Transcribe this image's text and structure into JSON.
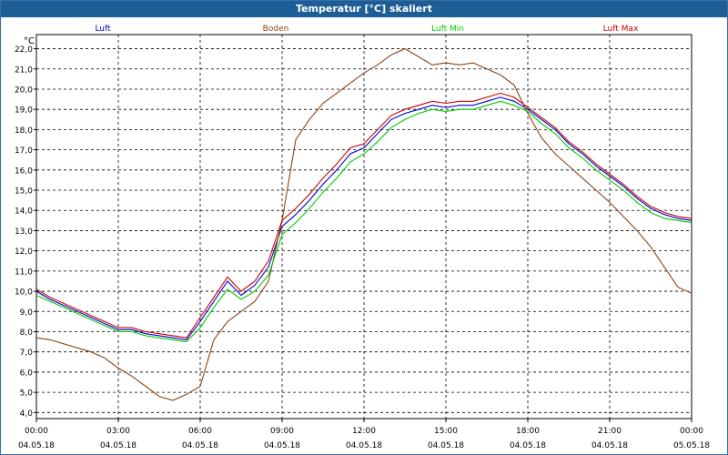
{
  "window": {
    "title": "Temperatur [°C] skaliert"
  },
  "colors": {
    "background": "#ffffff",
    "titlebar": "#1d5e96",
    "grid": "#000000",
    "axis": "#000000"
  },
  "chart_data": {
    "type": "line",
    "title": "Temperatur [°C] skaliert",
    "ylabel": "°C",
    "xlabel": "",
    "ylim": [
      3.7,
      22.7
    ],
    "yticks": [
      4.0,
      5.0,
      6.0,
      7.0,
      8.0,
      9.0,
      10.0,
      11.0,
      12.0,
      13.0,
      14.0,
      15.0,
      16.0,
      17.0,
      18.0,
      19.0,
      20.0,
      21.0,
      22.0
    ],
    "ytick_labels": [
      "4,0",
      "5,0",
      "6,0",
      "7,0",
      "8,0",
      "9,0",
      "10,0",
      "11,0",
      "12,0",
      "13,0",
      "14,0",
      "15,0",
      "16,0",
      "17,0",
      "18,0",
      "19,0",
      "20,0",
      "21,0",
      "22,0"
    ],
    "xlim": [
      0,
      24
    ],
    "xticks": [
      0,
      3,
      6,
      9,
      12,
      15,
      18,
      21,
      24
    ],
    "xtick_times": [
      "00:00",
      "03:00",
      "06:00",
      "09:00",
      "12:00",
      "15:00",
      "18:00",
      "21:00",
      "00:00"
    ],
    "xtick_dates": [
      "04.05.18",
      "04.05.18",
      "04.05.18",
      "04.05.18",
      "04.05.18",
      "04.05.18",
      "04.05.18",
      "04.05.18",
      "05.05.18"
    ],
    "grid": true,
    "legend_position": "top",
    "series": [
      {
        "name": "Luft",
        "color": "#0000cc",
        "points": [
          [
            0,
            10.0
          ],
          [
            0.5,
            9.6
          ],
          [
            1,
            9.3
          ],
          [
            1.5,
            9.0
          ],
          [
            2,
            8.7
          ],
          [
            2.5,
            8.4
          ],
          [
            3,
            8.1
          ],
          [
            3.5,
            8.1
          ],
          [
            4,
            7.9
          ],
          [
            4.5,
            7.8
          ],
          [
            5,
            7.7
          ],
          [
            5.5,
            7.6
          ],
          [
            6,
            8.5
          ],
          [
            6.5,
            9.5
          ],
          [
            7,
            10.5
          ],
          [
            7.5,
            9.8
          ],
          [
            8,
            10.3
          ],
          [
            8.5,
            11.2
          ],
          [
            9,
            13.2
          ],
          [
            9.5,
            13.8
          ],
          [
            10,
            14.5
          ],
          [
            10.5,
            15.3
          ],
          [
            11,
            16.0
          ],
          [
            11.5,
            16.8
          ],
          [
            12,
            17.1
          ],
          [
            12.5,
            17.8
          ],
          [
            13,
            18.5
          ],
          [
            13.5,
            18.8
          ],
          [
            14,
            19.0
          ],
          [
            14.5,
            19.2
          ],
          [
            15,
            19.1
          ],
          [
            15.5,
            19.2
          ],
          [
            16,
            19.2
          ],
          [
            16.5,
            19.4
          ],
          [
            17,
            19.6
          ],
          [
            17.5,
            19.4
          ],
          [
            18,
            19.0
          ],
          [
            18.5,
            18.5
          ],
          [
            19,
            18.0
          ],
          [
            19.5,
            17.3
          ],
          [
            20,
            16.8
          ],
          [
            20.5,
            16.2
          ],
          [
            21,
            15.7
          ],
          [
            21.5,
            15.2
          ],
          [
            22,
            14.6
          ],
          [
            22.5,
            14.1
          ],
          [
            23,
            13.8
          ],
          [
            23.5,
            13.6
          ],
          [
            24,
            13.5
          ]
        ]
      },
      {
        "name": "Boden",
        "color": "#8b4513",
        "points": [
          [
            0,
            7.7
          ],
          [
            0.5,
            7.6
          ],
          [
            1,
            7.4
          ],
          [
            1.5,
            7.2
          ],
          [
            2,
            7.0
          ],
          [
            2.5,
            6.7
          ],
          [
            3,
            6.2
          ],
          [
            3.5,
            5.8
          ],
          [
            4,
            5.3
          ],
          [
            4.5,
            4.8
          ],
          [
            5,
            4.6
          ],
          [
            5.5,
            4.9
          ],
          [
            6,
            5.3
          ],
          [
            6.5,
            7.6
          ],
          [
            7,
            8.5
          ],
          [
            7.5,
            9.0
          ],
          [
            8,
            9.5
          ],
          [
            8.5,
            10.5
          ],
          [
            9,
            13.5
          ],
          [
            9.5,
            17.5
          ],
          [
            10,
            18.5
          ],
          [
            10.5,
            19.3
          ],
          [
            11,
            19.8
          ],
          [
            11.5,
            20.3
          ],
          [
            12,
            20.8
          ],
          [
            12.5,
            21.2
          ],
          [
            13,
            21.7
          ],
          [
            13.5,
            22.0
          ],
          [
            14,
            21.6
          ],
          [
            14.5,
            21.2
          ],
          [
            15,
            21.3
          ],
          [
            15.5,
            21.2
          ],
          [
            16,
            21.3
          ],
          [
            16.5,
            21.0
          ],
          [
            17,
            20.7
          ],
          [
            17.5,
            20.2
          ],
          [
            18,
            18.8
          ],
          [
            18.5,
            17.6
          ],
          [
            19,
            16.8
          ],
          [
            19.5,
            16.2
          ],
          [
            20,
            15.6
          ],
          [
            20.5,
            15.0
          ],
          [
            21,
            14.4
          ],
          [
            21.5,
            13.7
          ],
          [
            22,
            13.0
          ],
          [
            22.5,
            12.2
          ],
          [
            23,
            11.2
          ],
          [
            23.5,
            10.2
          ],
          [
            24,
            9.9
          ]
        ]
      },
      {
        "name": "Luft Min",
        "color": "#00cc00",
        "points": [
          [
            0,
            9.8
          ],
          [
            0.5,
            9.5
          ],
          [
            1,
            9.2
          ],
          [
            1.5,
            8.9
          ],
          [
            2,
            8.6
          ],
          [
            2.5,
            8.3
          ],
          [
            3,
            8.0
          ],
          [
            3.5,
            8.0
          ],
          [
            4,
            7.8
          ],
          [
            4.5,
            7.7
          ],
          [
            5,
            7.6
          ],
          [
            5.5,
            7.5
          ],
          [
            6,
            8.2
          ],
          [
            6.5,
            9.2
          ],
          [
            7,
            10.1
          ],
          [
            7.5,
            9.6
          ],
          [
            8,
            10.0
          ],
          [
            8.5,
            10.8
          ],
          [
            9,
            12.8
          ],
          [
            9.5,
            13.4
          ],
          [
            10,
            14.1
          ],
          [
            10.5,
            14.9
          ],
          [
            11,
            15.6
          ],
          [
            11.5,
            16.4
          ],
          [
            12,
            16.8
          ],
          [
            12.5,
            17.4
          ],
          [
            13,
            18.1
          ],
          [
            13.5,
            18.5
          ],
          [
            14,
            18.8
          ],
          [
            14.5,
            19.0
          ],
          [
            15,
            18.9
          ],
          [
            15.5,
            19.0
          ],
          [
            16,
            19.0
          ],
          [
            16.5,
            19.2
          ],
          [
            17,
            19.4
          ],
          [
            17.5,
            19.2
          ],
          [
            18,
            18.9
          ],
          [
            18.5,
            18.3
          ],
          [
            19,
            17.8
          ],
          [
            19.5,
            17.1
          ],
          [
            20,
            16.6
          ],
          [
            20.5,
            16.0
          ],
          [
            21,
            15.5
          ],
          [
            21.5,
            15.0
          ],
          [
            22,
            14.4
          ],
          [
            22.5,
            13.9
          ],
          [
            23,
            13.6
          ],
          [
            23.5,
            13.5
          ],
          [
            24,
            13.4
          ]
        ]
      },
      {
        "name": "Luft Max",
        "color": "#cc0000",
        "points": [
          [
            0,
            10.1
          ],
          [
            0.5,
            9.7
          ],
          [
            1,
            9.4
          ],
          [
            1.5,
            9.1
          ],
          [
            2,
            8.8
          ],
          [
            2.5,
            8.5
          ],
          [
            3,
            8.2
          ],
          [
            3.5,
            8.2
          ],
          [
            4,
            8.0
          ],
          [
            4.5,
            7.9
          ],
          [
            5,
            7.8
          ],
          [
            5.5,
            7.7
          ],
          [
            6,
            8.7
          ],
          [
            6.5,
            9.7
          ],
          [
            7,
            10.7
          ],
          [
            7.5,
            10.0
          ],
          [
            8,
            10.5
          ],
          [
            8.5,
            11.5
          ],
          [
            9,
            13.5
          ],
          [
            9.5,
            14.1
          ],
          [
            10,
            14.8
          ],
          [
            10.5,
            15.6
          ],
          [
            11,
            16.3
          ],
          [
            11.5,
            17.1
          ],
          [
            12,
            17.3
          ],
          [
            12.5,
            18.0
          ],
          [
            13,
            18.7
          ],
          [
            13.5,
            19.0
          ],
          [
            14,
            19.2
          ],
          [
            14.5,
            19.4
          ],
          [
            15,
            19.3
          ],
          [
            15.5,
            19.4
          ],
          [
            16,
            19.4
          ],
          [
            16.5,
            19.6
          ],
          [
            17,
            19.8
          ],
          [
            17.5,
            19.6
          ],
          [
            18,
            19.1
          ],
          [
            18.5,
            18.6
          ],
          [
            19,
            18.1
          ],
          [
            19.5,
            17.4
          ],
          [
            20,
            16.9
          ],
          [
            20.5,
            16.3
          ],
          [
            21,
            15.8
          ],
          [
            21.5,
            15.3
          ],
          [
            22,
            14.7
          ],
          [
            22.5,
            14.2
          ],
          [
            23,
            13.9
          ],
          [
            23.5,
            13.7
          ],
          [
            24,
            13.6
          ]
        ]
      }
    ]
  }
}
